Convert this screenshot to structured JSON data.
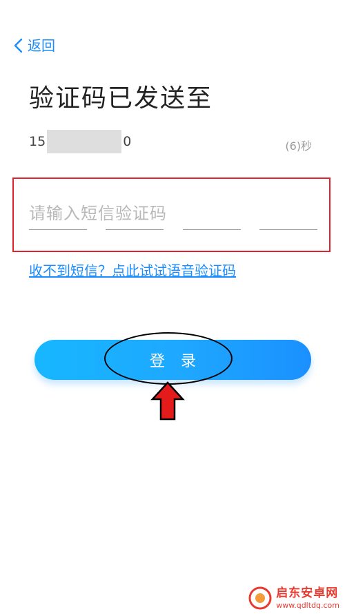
{
  "nav": {
    "back_label": "返回",
    "back_icon": "chevron-left-icon"
  },
  "title": "验证码已发送至",
  "phone": {
    "prefix": "15",
    "suffix": "0"
  },
  "countdown": "(6)秒",
  "code_input": {
    "placeholder": "请输入短信验证码",
    "slots": 4
  },
  "voice_link": "收不到短信？点此试试语音验证码",
  "login_button": "登 录",
  "colors": {
    "accent": "#1a8cff",
    "highlight": "#e0242f",
    "arrow": "#e31b1b",
    "button_start": "#17b7ff",
    "button_end": "#1a90ff"
  },
  "watermark": {
    "name": "启东安卓网",
    "url": "www.qdltdq.com"
  }
}
